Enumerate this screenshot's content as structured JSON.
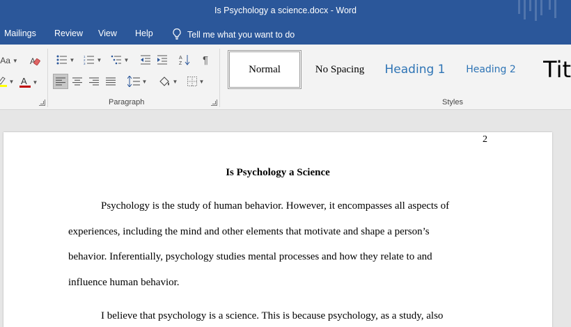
{
  "window": {
    "title": "Is Psychology a science.docx  -  Word"
  },
  "menu": {
    "tabs": [
      "Mailings",
      "Review",
      "View",
      "Help"
    ],
    "tell_me": "Tell me what you want to do",
    "tell_me_icon": "lightbulb-icon"
  },
  "ribbon": {
    "font_group_partial": {
      "change_case_label": "Aa",
      "font_color": "#c00000",
      "highlight_color": "#ffff00"
    },
    "paragraph_label": "Paragraph",
    "styles_label": "Styles",
    "styles": {
      "normal": "Normal",
      "no_spacing": "No Spacing",
      "heading1": "Heading 1",
      "heading2": "Heading 2",
      "title": "Tit"
    },
    "accent": "#2b579a",
    "heading_color": "#2e74b5"
  },
  "document": {
    "page_number": "2",
    "title": "Is Psychology a Science",
    "lines": [
      "Psychology is the study of human behavior. However, it encompasses all aspects of",
      "experiences, including the mind and other elements that motivate and shape a person’s",
      "behavior. Inferentially, psychology studies mental processes and how they relate to and",
      "influence human behavior.",
      "I believe that psychology is a science. This is because psychology, as a study, also"
    ]
  }
}
